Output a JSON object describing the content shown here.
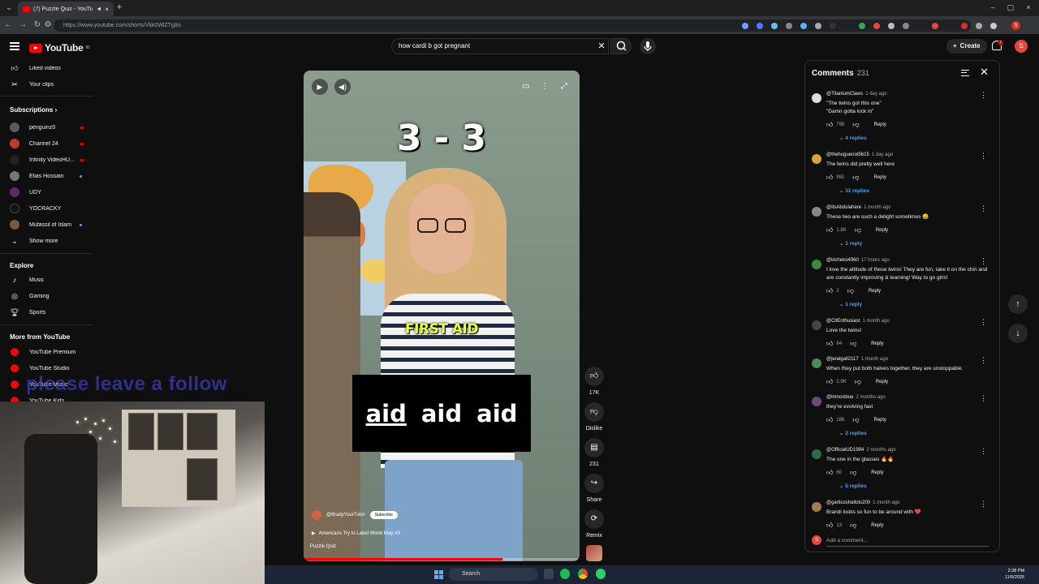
{
  "browser": {
    "tab_title": "(7) Puzzle Quiz - YouTube",
    "url": "https://www.youtube.com/shorts/Vkk0WlZTg8o"
  },
  "header": {
    "logo_text": "YouTube",
    "logo_sup": "80",
    "search_value": "how cardi b got pregnant",
    "create_label": "Create",
    "notif_count": "7",
    "avatar_letter": "S"
  },
  "sidebar": {
    "top_items": [
      {
        "label": "Liked videos",
        "icon": "thumbs-up-icon"
      },
      {
        "label": "Your clips",
        "icon": "scissors-icon"
      }
    ],
    "subscriptions_title": "Subscriptions",
    "subscriptions": [
      {
        "label": "penguinz0",
        "status": "live",
        "color": "#5a5a5a"
      },
      {
        "label": "Channel 24",
        "status": "live",
        "color": "#c0392b"
      },
      {
        "label": "Infinity VideoHU...",
        "status": "live",
        "color": "#222222"
      },
      {
        "label": "Elias Hossain",
        "status": "new",
        "color": "#777777"
      },
      {
        "label": "UDY",
        "status": "",
        "color": "#5d2a6e"
      },
      {
        "label": "YOCRACKY",
        "status": "",
        "color": "#111111"
      },
      {
        "label": "Mufassil of Islam",
        "status": "new",
        "color": "#7a5a3a"
      }
    ],
    "show_more": "Show more",
    "explore_title": "Explore",
    "explore": [
      {
        "label": "Music",
        "icon": "music-note-icon"
      },
      {
        "label": "Gaming",
        "icon": "gamepad-icon"
      },
      {
        "label": "Sports",
        "icon": "trophy-icon"
      }
    ],
    "more_title": "More from YouTube",
    "more": [
      {
        "label": "YouTube Premium"
      },
      {
        "label": "YouTube Studio"
      },
      {
        "label": "YouTube Music"
      },
      {
        "label": "YouTube Kids"
      }
    ]
  },
  "overlay": {
    "follow_text": "please leave a follow"
  },
  "video": {
    "score": "3 - 3",
    "tag": "FIRST AID",
    "caption_words": [
      "aid",
      "aid",
      "aid"
    ],
    "channel_handle": "@BradyYourTutor",
    "subscribe": "Subscribe",
    "title": "Americans Try to Label World Map #3",
    "channel_name": "Puzzle Quiz",
    "progress": 0.72
  },
  "actions": {
    "likes": "17K",
    "dislike": "Dislike",
    "comments": "231",
    "share": "Share",
    "remix": "Remix"
  },
  "comments": {
    "title": "Comments",
    "count": "231",
    "add_placeholder": "Add a comment...",
    "reply_label": "Reply",
    "items": [
      {
        "author": "@TitaniumClaws",
        "age": "1 day ago",
        "text": "\"The twins got this one\"\n\"Damn gotta lock in\"",
        "likes": "795",
        "replies": "4 replies",
        "color": "#dddddd"
      },
      {
        "author": "@thehuguenot5615",
        "age": "1 day ago",
        "text": "The twins did pretty well here",
        "likes": "991",
        "replies": "11 replies",
        "color": "#d6a53a"
      },
      {
        "author": "@ItsAbdulahere",
        "age": "1 month ago",
        "text": "These two are such a delight sometimes 😀",
        "likes": "1.8K",
        "replies": "1 reply",
        "color": "#888888"
      },
      {
        "author": "@kicheko4960",
        "age": "17 hours ago",
        "text": "I love the attitude of these twins! They are fun, take it on the chin and are constantly improving & learning! Way to go girls!",
        "likes": "2",
        "replies": "1 reply",
        "color": "#3b8a3e"
      },
      {
        "author": "@CltEnthusiast",
        "age": "1 month ago",
        "text": "Love the twins!",
        "likes": "64",
        "replies": "",
        "color": "#444444"
      },
      {
        "author": "@jeralgall2117",
        "age": "1 month ago",
        "text": "When they put both halves together, they are unstoppable.",
        "likes": "2.9K",
        "replies": "",
        "color": "#4a8a5a"
      },
      {
        "author": "@lmnoxblue",
        "age": "2 months ago",
        "text": "they're evolving fast",
        "likes": "186",
        "replies": "2 replies",
        "color": "#6a4a7a"
      },
      {
        "author": "@OfficialUD1994",
        "age": "2 months ago",
        "text": "The one in the glasses 🔥🔥",
        "likes": "60",
        "replies": "5 replies",
        "color": "#2a6a4a"
      },
      {
        "author": "@garlicoshallots200",
        "age": "1 month ago",
        "text": "Brandi looks so fun to be around with ❤️",
        "likes": "13",
        "replies": "",
        "color": "#a08050"
      }
    ]
  },
  "taskbar": {
    "search_label": "Search",
    "time": "2:38 PM",
    "date": "11/5/2025"
  }
}
